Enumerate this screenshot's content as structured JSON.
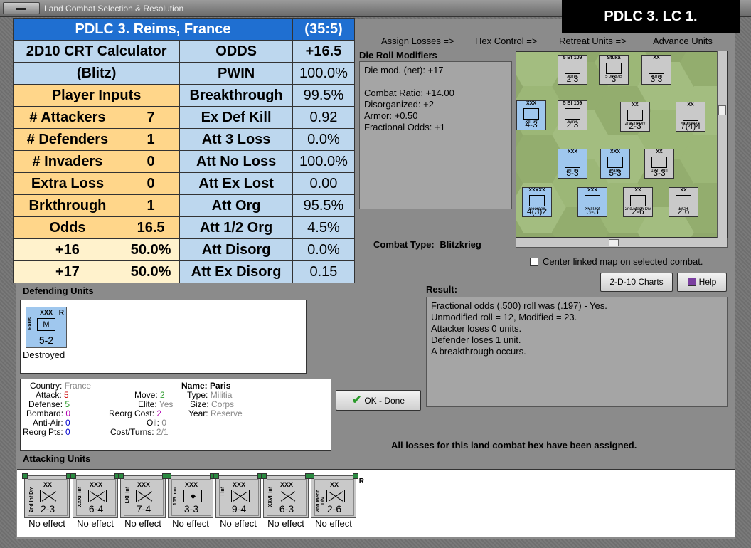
{
  "window": {
    "title": "Land Combat Selection & Resolution"
  },
  "banner": "PDLC 3.  LC 1.",
  "steps": [
    "Assign Losses =>",
    "Hex Control =>",
    "Retreat Units =>",
    "Advance Units"
  ],
  "crt": {
    "header_location": "PDLC 3.  Reims, France",
    "header_hex": "(35:5)",
    "calc_title": "2D10 CRT Calculator",
    "calc_sub": "(Blitz)",
    "player_inputs": "Player Inputs",
    "inputs": [
      {
        "label": "# Attackers",
        "value": "7"
      },
      {
        "label": "# Defenders",
        "value": "1"
      },
      {
        "label": "# Invaders",
        "value": "0"
      },
      {
        "label": "Extra Loss",
        "value": "0"
      },
      {
        "label": "Brkthrough",
        "value": "1"
      },
      {
        "label": "Odds",
        "value": "16.5"
      },
      {
        "label": "+16",
        "value": "50.0%"
      },
      {
        "label": "+17",
        "value": "50.0%"
      }
    ],
    "results": [
      {
        "label": "ODDS",
        "value": "+16.5"
      },
      {
        "label": "PWIN",
        "value": "100.0%"
      },
      {
        "label": "Breakthrough",
        "value": "99.5%"
      },
      {
        "label": "Ex Def Kill",
        "value": "0.92"
      },
      {
        "label": "Att 3 Loss",
        "value": "0.0%"
      },
      {
        "label": "Att No Loss",
        "value": "100.0%"
      },
      {
        "label": "Att Ex Lost",
        "value": "0.00"
      },
      {
        "label": "Att Org",
        "value": "95.5%"
      },
      {
        "label": "Att 1/2 Org",
        "value": "4.5%"
      },
      {
        "label": "Att Disorg",
        "value": "0.0%"
      },
      {
        "label": "Att Ex Disorg",
        "value": "0.15"
      }
    ]
  },
  "die_roll": {
    "title": "Die Roll Modifiers",
    "lines": [
      "Die mod. (net): +17",
      "",
      "Combat Ratio: +14.00",
      "Disorganized: +2",
      "Armor: +0.50",
      "Fractional Odds: +1"
    ]
  },
  "combat_type": {
    "label": "Combat Type:",
    "value": "Blitzkrieg"
  },
  "center_map": "Center linked map on selected combat.",
  "buttons": {
    "charts": "2-D-10 Charts",
    "help": "Help",
    "ok": "OK - Done"
  },
  "result": {
    "title": "Result:",
    "lines": [
      "Fractional odds (.500) roll was (.197)  - Yes.",
      "Unmodified roll = 12, Modified = 23.",
      "Attacker loses 0 units.",
      "Defender loses 1 unit.",
      "A breakthrough occurs."
    ]
  },
  "defending": {
    "title": "Defending Units",
    "unit": {
      "size": "XXX",
      "name": "Paris",
      "icon": "M",
      "value": "5-2",
      "reserve": "R",
      "status": "Destroyed"
    }
  },
  "info": {
    "country_l": "Country:",
    "country_v": "France",
    "attack_l": "Attack:",
    "attack_v": "5",
    "defense_l": "Defense:",
    "defense_v": "5",
    "bombard_l": "Bombard:",
    "bombard_v": "0",
    "antiair_l": "Anti-Air:",
    "antiair_v": "0",
    "reorg_l": "Reorg Pts:",
    "reorg_v": "0",
    "move_l": "Move:",
    "move_v": "2",
    "elite_l": "Elite:",
    "elite_v": "Yes",
    "reorgcost_l": "Reorg Cost:",
    "reorgcost_v": "2",
    "oil_l": "Oil:",
    "oil_v": "0",
    "costturns_l": "Cost/Turns:",
    "costturns_v": "2/1",
    "name_l": "Name:",
    "name_v": "Paris",
    "type_l": "Type:",
    "type_v": "Militia",
    "size_l": "Size:",
    "size_v": "Corps",
    "year_l": "Year:",
    "year_v": "Reserve"
  },
  "all_losses": "All losses for this land combat hex have been assigned.",
  "attacking": {
    "title": "Attacking Units",
    "units": [
      {
        "size": "XX",
        "name": "2nd Inf Div",
        "value": "2-3",
        "icon": "x",
        "status": "No effect",
        "reserve": ""
      },
      {
        "size": "XXX",
        "name": "XXXII Inf",
        "value": "6-4",
        "icon": "x",
        "status": "No effect",
        "reserve": ""
      },
      {
        "size": "XXX",
        "name": "LXII Inf",
        "value": "7-4",
        "icon": "x",
        "status": "No effect",
        "reserve": ""
      },
      {
        "size": "XXX",
        "name": "105 mm",
        "value": "3-3",
        "icon": "dot",
        "status": "No effect",
        "reserve": ""
      },
      {
        "size": "XXX",
        "name": "I Inf",
        "value": "9-4",
        "icon": "x",
        "status": "No effect",
        "reserve": "R"
      },
      {
        "size": "XXX",
        "name": "XXVII Inf",
        "value": "6-3",
        "icon": "x",
        "status": "No effect",
        "reserve": ""
      },
      {
        "size": "XX",
        "name": "2nd Mech Div",
        "value": "2-6",
        "icon": "x",
        "status": "No effect",
        "reserve": "R"
      }
    ]
  },
  "map_counters": [
    {
      "label": "5 Bf 109",
      "sub": "Emil",
      "val": "2 3"
    },
    {
      "label": "Stuka",
      "sub": "5 Ju 87B",
      "val": "3"
    },
    {
      "label": "XX",
      "sub": "Ill mm",
      "val": "3 3"
    },
    {
      "label": "XXX",
      "sub": "XIII Inf",
      "val": "4-3"
    },
    {
      "label": "5 Bf 109",
      "sub": "Emil",
      "val": "2 3"
    },
    {
      "label": "XX",
      "sub": "2nd Inf Div",
      "val": "2-3"
    },
    {
      "label": "XX",
      "sub": "Armored",
      "val": "7(4)4"
    },
    {
      "label": "XXX",
      "sub": "XIII Inf",
      "val": "5-3"
    },
    {
      "label": "XXX",
      "sub": "Paris",
      "val": "5-3"
    },
    {
      "label": "XX",
      "sub": "10th mm",
      "val": "3-3"
    },
    {
      "label": "XXXXX",
      "sub": "Georges",
      "val": "4(3)2"
    },
    {
      "label": "XXX",
      "sub": "XVIII Inf",
      "val": "3-3"
    },
    {
      "label": "XX",
      "sub": "2nd Mech Div",
      "val": "2-6"
    },
    {
      "label": "XX",
      "sub": "DCR",
      "val": "2 6"
    }
  ]
}
